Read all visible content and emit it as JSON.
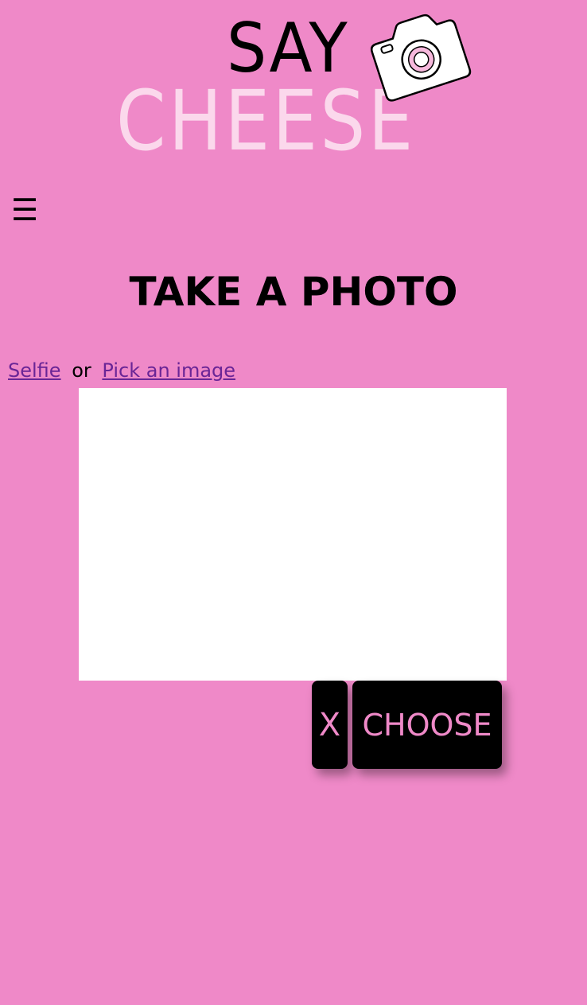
{
  "logo": {
    "line1": "SAY",
    "line2": "CHEESE"
  },
  "menu": {
    "icon": "hamburger-icon",
    "glyph": "☰"
  },
  "page": {
    "title": "TAKE A PHOTO"
  },
  "source": {
    "selfie_label": "Selfie",
    "separator": "or",
    "pick_label": "Pick an image"
  },
  "actions": {
    "clear_label": "X",
    "choose_label": "CHOOSE"
  },
  "colors": {
    "background": "#ef89c8",
    "logo_cheese": "#fbd8ec",
    "link": "#6a2596",
    "button_bg": "#000000",
    "button_text": "#ef89c8",
    "preview_bg": "#ffffff"
  }
}
